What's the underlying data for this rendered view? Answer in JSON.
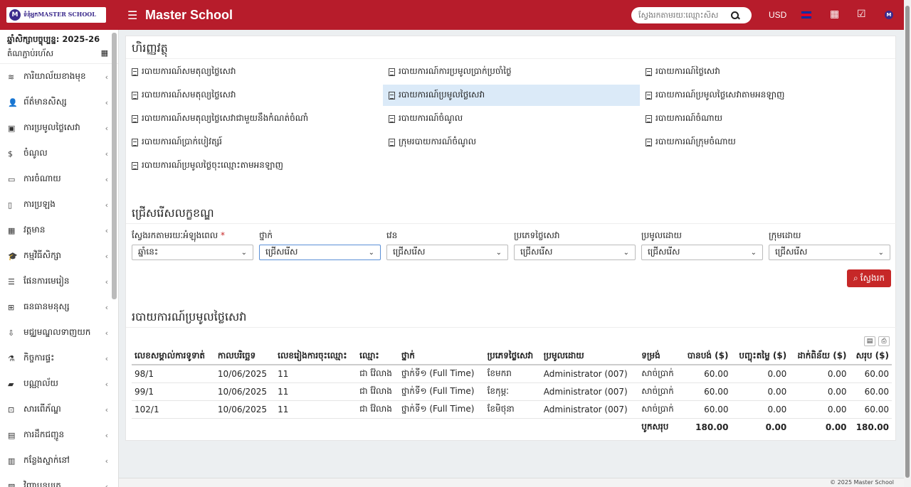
{
  "topbar": {
    "logo_text": "ទំនុំអ្នកMASTER SCHOOL",
    "logo_mark": "M",
    "brand": "Master School",
    "search_placeholder": "ស្វែងរកតាមរយៈឈ្មោះសិស",
    "currency": "USD",
    "user_badge": "M"
  },
  "sidebar": {
    "year_label": "ឆ្នាំសិក្សាបច្ចុប្បន្ន: 2025-26",
    "year_sub": "តំណភ្ជាប់រហ័ស",
    "items": [
      {
        "label": "ការិយាល័យខាងមុខ",
        "icon": "≋"
      },
      {
        "label": "ព័ត៌មានសិស្ស",
        "icon": "👤"
      },
      {
        "label": "ការប្រមូលថ្លៃសេវា",
        "icon": "▣"
      },
      {
        "label": "ចំណូល",
        "icon": "$"
      },
      {
        "label": "ការចំណាយ",
        "icon": "▭"
      },
      {
        "label": "ការប្រឡង",
        "icon": "▯"
      },
      {
        "label": "វត្តមាន",
        "icon": "▦"
      },
      {
        "label": "កម្មវិធីសិក្សា",
        "icon": "🎓"
      },
      {
        "label": "ផែនការមេរៀន",
        "icon": "☰"
      },
      {
        "label": "ធនធានមនុស្ស",
        "icon": "⊞"
      },
      {
        "label": "មជ្ឈមណ្ឌលទាញយក",
        "icon": "⇩"
      },
      {
        "label": "កិច្ចការផ្ទះ",
        "icon": "⚗"
      },
      {
        "label": "បណ្ណាល័យ",
        "icon": "▰"
      },
      {
        "label": "សារពើភ័ណ្ឌ",
        "icon": "⊡"
      },
      {
        "label": "ការដឹកជញ្ជូន",
        "icon": "▤"
      },
      {
        "label": "កន្លែងស្នាក់នៅ",
        "icon": "▥"
      },
      {
        "label": "វិញ្ញាបនបត្រ",
        "icon": "▧"
      }
    ]
  },
  "reports": {
    "title": "ហិរញ្ញវត្ថុ",
    "links": [
      "របាយការណ៍សមតុល្យថ្លៃសេវា",
      "របាយការណ៍ការប្រមូលប្រាក់ប្រចាំថ្ងៃ",
      "របាយការណ៍ថ្លៃសេវា",
      "របាយការណ៍សមតុល្យថ្លៃសេវា",
      "របាយការណ៍ប្រមូលថ្លៃសេវា",
      "របាយការណ៍ប្រមូលថ្លៃសេវាតាមអនឡាញ",
      "របាយការណ៍សមតុល្យថ្លៃសេវាជាមួយនឹងកំណត់ចំណាំ",
      "របាយការណ៍ចំណូល",
      "របាយការណ៍ចំណាយ",
      "របាយការណ៍ប្រាក់បៀវត្សរ៍",
      "ក្រុមរបាយការណ៍ចំណូល",
      "របាយការណ៍ក្រុមចំណាយ",
      "របាយការណ៍ប្រមូលថ្លៃចុះឈ្មោះតាមអនឡាញ"
    ]
  },
  "filters": {
    "title": "ជ្រើសរើសលក្ខខណ្ឌ",
    "fields": [
      {
        "label": "ស្វែងរកតាមរយៈអំឡុងពេល",
        "value": "ឆ្នាំនេះ",
        "required": "*"
      },
      {
        "label": "ថ្នាក់",
        "value": "ជ្រើសរើស"
      },
      {
        "label": "វេន",
        "value": "ជ្រើសរើស"
      },
      {
        "label": "ប្រភេទថ្លៃសេវា",
        "value": "ជ្រើសរើស"
      },
      {
        "label": "ប្រមូលដោយ",
        "value": "ជ្រើសរើស"
      },
      {
        "label": "ក្រុមដោយ",
        "value": "ជ្រើសរើស"
      }
    ],
    "search_label": "ស្វែងរក"
  },
  "result": {
    "title": "របាយការណ៍ប្រមូលថ្លៃសេវា",
    "columns": [
      "លេខសម្គាល់ការទូទាត់",
      "កាលបរិច្ឆេទ",
      "លេខរៀងការចុះឈ្មោះ",
      "ឈ្មោះ",
      "ថ្នាក់",
      "ប្រភេទថ្លៃសេវា",
      "ប្រមូលដោយ",
      "ទម្រង់",
      "បានបង់ ($)",
      "បញ្ចុះតម្លៃ ($)",
      "ដាក់ពិន័យ ($)",
      "សរុប ($)"
    ],
    "rows": [
      [
        "98/1",
        "10/06/2025",
        "11",
        "ជា វ៉ែលាង",
        "ថ្នាក់ទី១ (Full Time)",
        "ខែមករា",
        "Administrator (007)",
        "សាច់ប្រាក់",
        "60.00",
        "0.00",
        "0.00",
        "60.00"
      ],
      [
        "99/1",
        "10/06/2025",
        "11",
        "ជា វ៉ែលាង",
        "ថ្នាក់ទី១ (Full Time)",
        "ខែកុម្ភៈ",
        "Administrator (007)",
        "សាច់ប្រាក់",
        "60.00",
        "0.00",
        "0.00",
        "60.00"
      ],
      [
        "102/1",
        "10/06/2025",
        "11",
        "ជា វ៉ែលាង",
        "ថ្នាក់ទី១ (Full Time)",
        "ខែមិថុនា",
        "Administrator (007)",
        "សាច់ប្រាក់",
        "60.00",
        "0.00",
        "0.00",
        "60.00"
      ]
    ],
    "total_label": "បូកសរុប",
    "totals": [
      "180.00",
      "0.00",
      "0.00",
      "180.00"
    ]
  },
  "footer": {
    "text": "© 2025 Master School"
  }
}
